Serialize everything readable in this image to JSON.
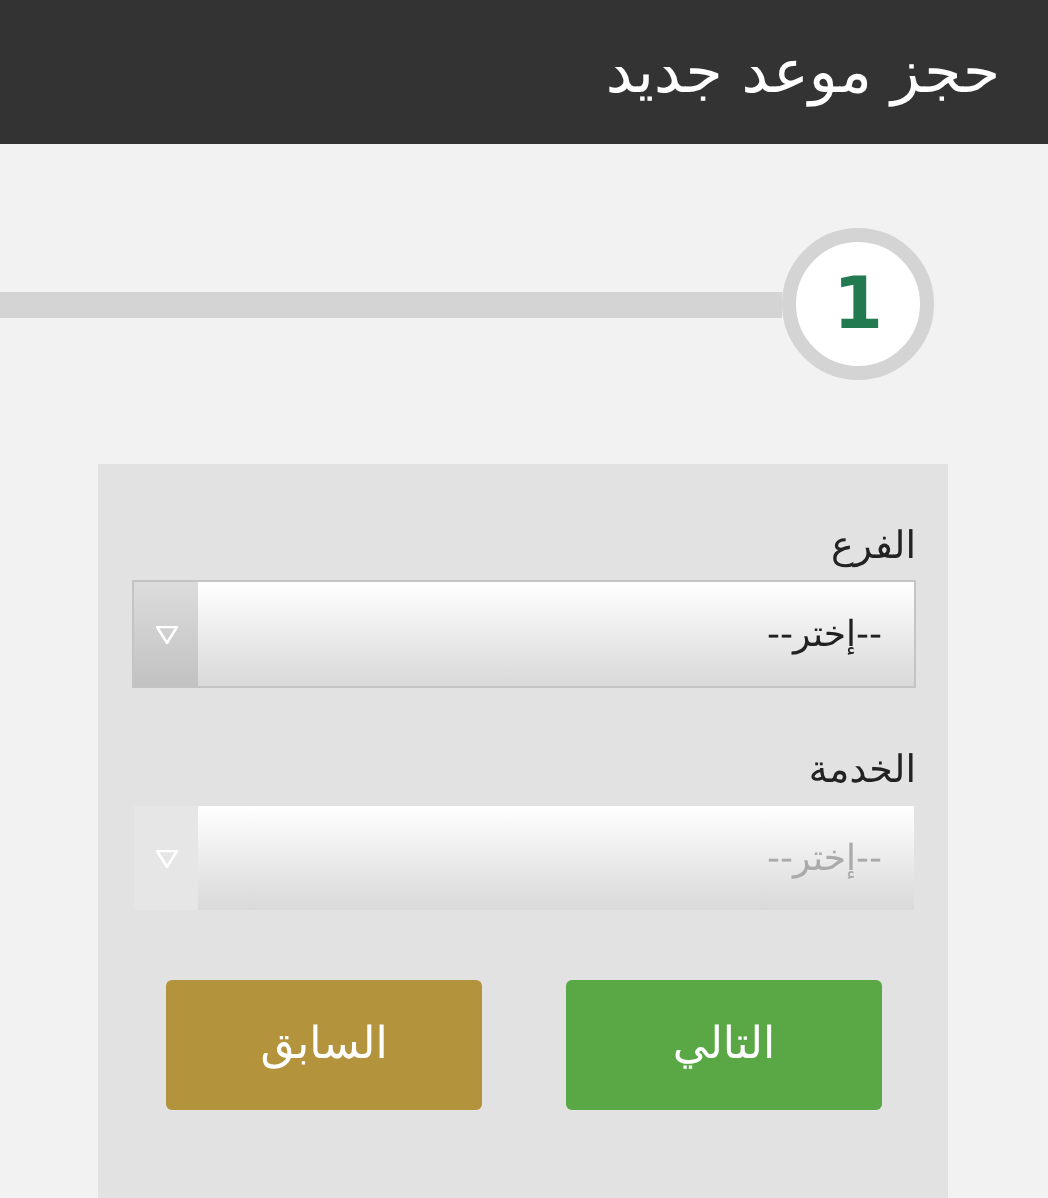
{
  "header": {
    "title": "حجز موعد جديد"
  },
  "steps": [
    {
      "number": "1",
      "selected": true
    }
  ],
  "fields": [
    {
      "label": "الفرع",
      "placeholder": "--إختر--",
      "disabled": false
    },
    {
      "label": "الخدمة",
      "placeholder": "--إختر--",
      "disabled": true
    }
  ],
  "buttons": [
    {
      "label": "التالي",
      "kind": "next"
    },
    {
      "label": "السابق",
      "kind": "previous"
    }
  ]
}
